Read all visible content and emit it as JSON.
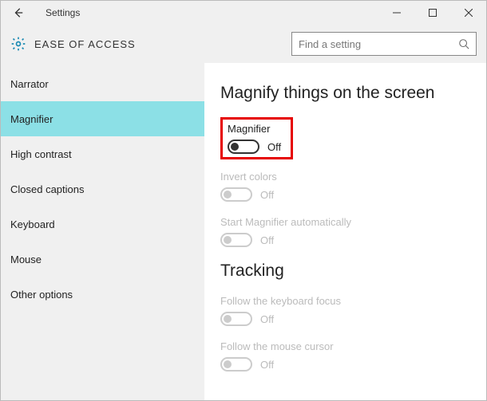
{
  "window": {
    "title": "Settings"
  },
  "header": {
    "page_title": "EASE OF ACCESS"
  },
  "search": {
    "placeholder": "Find a setting"
  },
  "sidebar": {
    "items": [
      {
        "label": "Narrator"
      },
      {
        "label": "Magnifier"
      },
      {
        "label": "High contrast"
      },
      {
        "label": "Closed captions"
      },
      {
        "label": "Keyboard"
      },
      {
        "label": "Mouse"
      },
      {
        "label": "Other options"
      }
    ]
  },
  "main": {
    "section1_heading": "Magnify things on the screen",
    "magnifier": {
      "label": "Magnifier",
      "state": "Off"
    },
    "invert": {
      "label": "Invert colors",
      "state": "Off"
    },
    "autostart": {
      "label": "Start Magnifier automatically",
      "state": "Off"
    },
    "section2_heading": "Tracking",
    "kbfocus": {
      "label": "Follow the keyboard focus",
      "state": "Off"
    },
    "mousecursor": {
      "label": "Follow the mouse cursor",
      "state": "Off"
    }
  }
}
